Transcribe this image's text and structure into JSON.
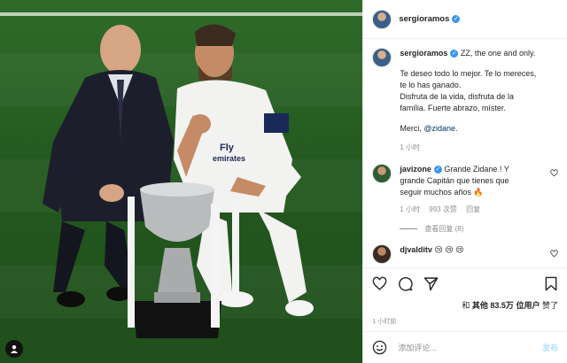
{
  "colors": {
    "link": "#00376b",
    "verified": "#3897f0",
    "muted": "#8e8e8e",
    "post_disabled": "#b2dffc",
    "pitch": "#2f6b2a"
  },
  "header": {
    "username": "sergioramos",
    "verified_icon": "verified-badge-icon"
  },
  "caption": {
    "username": "sergioramos",
    "line1": "ZZ, the one and only.",
    "para2_l1": "Te deseo todo lo mejor. Te lo mereces,",
    "para2_l2": "te lo has ganado.",
    "para3_l1": "Disfruta de la vida, disfruta de la",
    "para3_l2": "família. Fuerte abrazo, míster.",
    "merci": "Merci,",
    "mention": "@zidane",
    "mention_after": ".",
    "time": "1 小时"
  },
  "comments": [
    {
      "username": "javizone",
      "text_l1": "Grande Zidane ! Y",
      "text_l2": "grande Capitán que tienes que",
      "text_l3": "seguir muchos años",
      "emoji": "🔥",
      "time": "1 小时",
      "likes": "993 次赞",
      "reply": "回复"
    },
    {
      "username": "djvalditv",
      "emoji": "😢 😢 😢"
    }
  ],
  "view_replies": "查看回复 (8)",
  "actions": {
    "like": "heart-icon",
    "comment": "comment-icon",
    "share": "share-icon",
    "save": "bookmark-icon"
  },
  "likes": {
    "prefix": "和",
    "others": "其他",
    "count": "83.5万",
    "suffix1": "位用户",
    "suffix2": "赞了"
  },
  "time_ago": "1 小时前",
  "add_comment": {
    "placeholder": "添加评论...",
    "post_label": "发布",
    "emoji_icon": "smiley-icon"
  }
}
